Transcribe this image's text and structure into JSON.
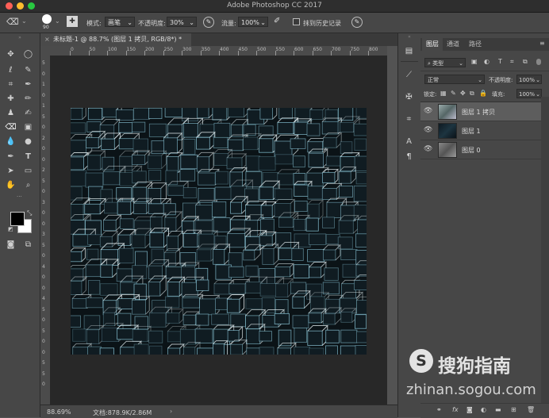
{
  "window": {
    "title": "Adobe Photoshop CC 2017",
    "traffic_colors": [
      "#fe5f57",
      "#febc2e",
      "#28c840"
    ]
  },
  "options_bar": {
    "brush_size": "90",
    "mode_label": "模式:",
    "mode_value": "画笔",
    "opacity_label": "不透明度:",
    "opacity_value": "30%",
    "flow_label": "流量:",
    "flow_value": "100%",
    "history_label": "抹到历史记录"
  },
  "document_tab": {
    "label": "未标题-1 @ 88.7% (图层 1 拷贝, RGB/8*) *"
  },
  "ruler": {
    "top_ticks": [
      "0",
      "50",
      "100",
      "150",
      "200",
      "250",
      "300",
      "350",
      "400",
      "450",
      "500",
      "550",
      "600",
      "650",
      "700",
      "750",
      "800"
    ],
    "left_ticks": [
      "5",
      "0",
      "1",
      "0",
      "1",
      "5",
      "0",
      "2",
      "0",
      "0",
      "2",
      "5",
      "0",
      "3",
      "0",
      "0",
      "3",
      "5",
      "0",
      "4",
      "0",
      "0",
      "4",
      "5",
      "0",
      "5",
      "0",
      "0",
      "5",
      "5",
      "0"
    ]
  },
  "status": {
    "zoom": "88.69%",
    "doc_info": "文档:878.9K/2.86M"
  },
  "panel": {
    "tabs": [
      "图层",
      "通道",
      "路径"
    ],
    "filter_label": "类型",
    "blend_mode": "正常",
    "opacity_label": "不透明度:",
    "opacity_value": "100%",
    "lock_label": "锁定:",
    "fill_label": "填充:",
    "fill_value": "100%",
    "layers": [
      {
        "name": "图层 1 拷贝",
        "selected": true
      },
      {
        "name": "图层 1",
        "selected": false
      },
      {
        "name": "图层 0",
        "selected": false
      }
    ]
  },
  "watermark": {
    "brand": "搜狗指南",
    "url": "zhinan.sogou.com",
    "logo_letter": "S"
  },
  "colors": {
    "foreground": "#000000",
    "background": "#ffffff",
    "accent_line": "#7fb7c8"
  }
}
